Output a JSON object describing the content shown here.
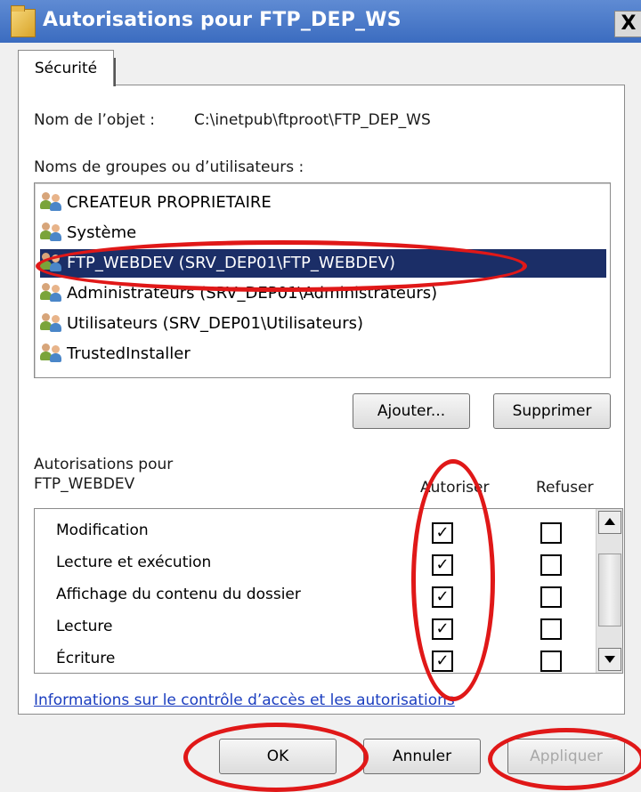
{
  "window": {
    "title": "Autorisations pour FTP_DEP_WS",
    "close_label": "X"
  },
  "tabs": [
    {
      "label": "Sécurité"
    }
  ],
  "object": {
    "label": "Nom de l’objet :",
    "path": "C:\\inetpub\\ftproot\\FTP_DEP_WS"
  },
  "groups": {
    "label": "Noms de groupes ou d’utilisateurs :",
    "items": [
      {
        "label": "CREATEUR PROPRIETAIRE"
      },
      {
        "label": "Système"
      },
      {
        "label": "FTP_WEBDEV (SRV_DEP01\\FTP_WEBDEV)",
        "selected": true
      },
      {
        "label": "Administrateurs (SRV_DEP01\\Administrateurs)"
      },
      {
        "label": "Utilisateurs (SRV_DEP01\\Utilisateurs)"
      },
      {
        "label": "TrustedInstaller"
      }
    ]
  },
  "buttons": {
    "add": "Ajouter...",
    "remove": "Supprimer",
    "ok": "OK",
    "cancel": "Annuler",
    "apply": "Appliquer"
  },
  "permissions": {
    "label_line1": "Autorisations pour",
    "label_line2": "FTP_WEBDEV",
    "allow_header": "Autoriser",
    "deny_header": "Refuser",
    "rows": [
      {
        "name": "Modification",
        "allow": true,
        "deny": false
      },
      {
        "name": "Lecture et exécution",
        "allow": true,
        "deny": false
      },
      {
        "name": "Affichage du contenu du dossier",
        "allow": true,
        "deny": false
      },
      {
        "name": "Lecture",
        "allow": true,
        "deny": false
      },
      {
        "name": "Écriture",
        "allow": true,
        "deny": false
      }
    ]
  },
  "help_link": "Informations sur le contrôle d’accès et les autorisations",
  "colors": {
    "selection": "#1b2e67",
    "annotation": "#e01818",
    "link": "#1a3dbf"
  }
}
